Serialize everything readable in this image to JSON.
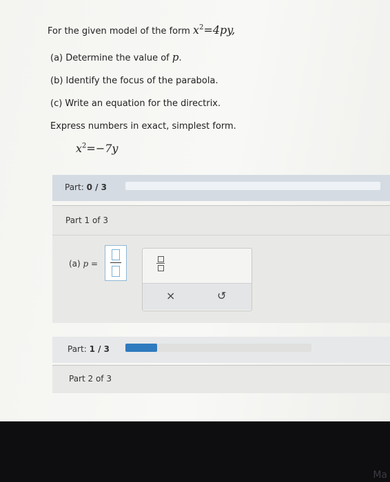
{
  "question": {
    "intro": "For the given model of the form",
    "model_base": "x",
    "model_exp": "2",
    "model_rhs": "=4py,",
    "items": [
      {
        "prefix": "(a) Determine the value of ",
        "var": "p",
        "suffix": "."
      },
      {
        "prefix": "(b) Identify the focus of the parabola.",
        "var": "",
        "suffix": ""
      },
      {
        "prefix": "(c) Write an equation for the directrix.",
        "var": "",
        "suffix": ""
      }
    ],
    "instruction": "Express numbers in exact, simplest form.",
    "equation_base": "x",
    "equation_exp": "2",
    "equation_rhs": "=−7y"
  },
  "part_status_1": {
    "label": "Part:",
    "value": "0 / 3",
    "progress": 0.0
  },
  "panel_1": {
    "title": "Part 1 of 3"
  },
  "answer": {
    "prefix": "(a) ",
    "var": "p",
    "equals": " ="
  },
  "tools": {
    "fraction_icon": "fraction-icon",
    "clear": "×",
    "undo": "↺"
  },
  "part_status_2": {
    "label": "Part:",
    "value": "1 / 3",
    "progress": 0.17
  },
  "panel_2": {
    "title": "Part 2 of 3"
  },
  "corner_mark": "Ma"
}
